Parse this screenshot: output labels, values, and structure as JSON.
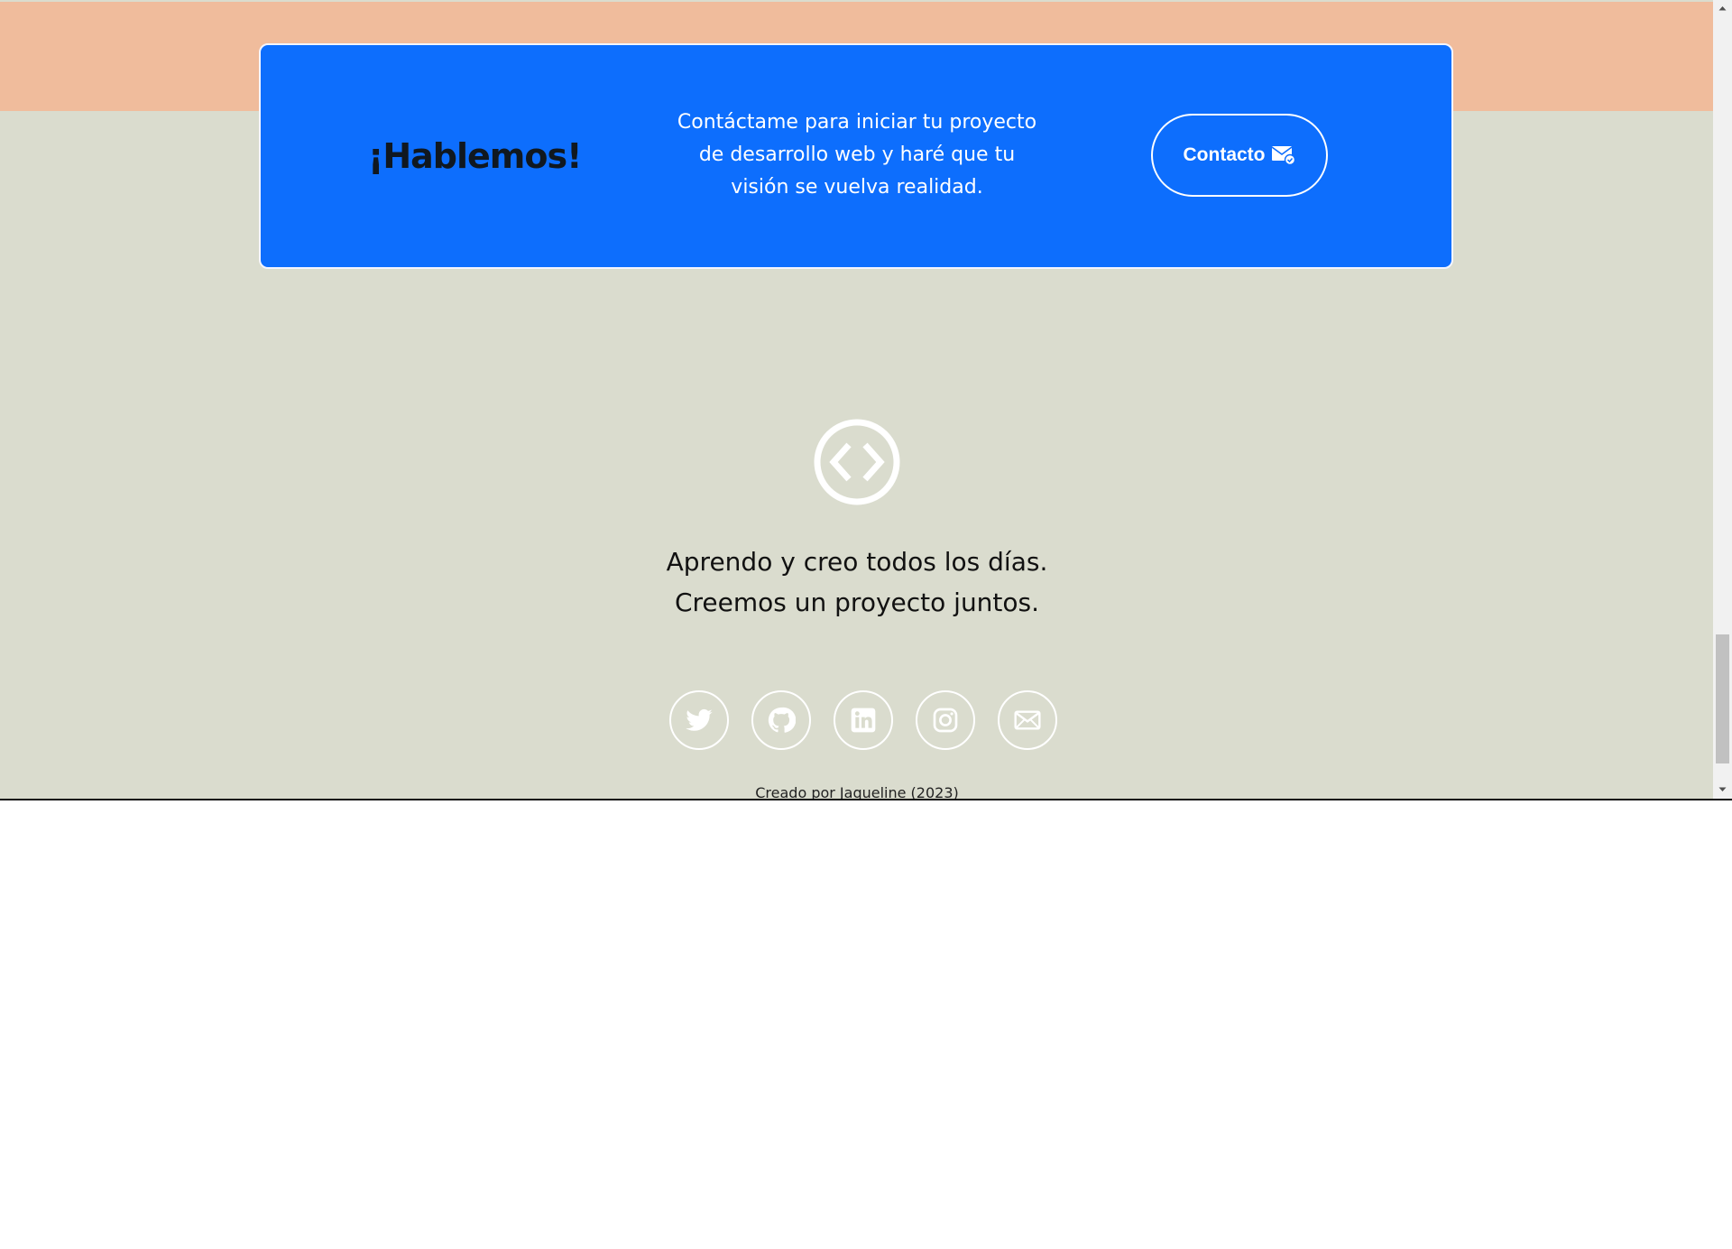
{
  "cta": {
    "title": "¡Hablemos!",
    "text": "Contáctame para iniciar tu proyecto de desarrollo web y haré que tu visión se vuelva realidad.",
    "button_label": "Contacto",
    "button_icon": "mail-check-icon"
  },
  "footer": {
    "logo_icon": "code-brackets-logo",
    "tagline_line1": "Aprendo y creo todos los días.",
    "tagline_line2": "Creemos un proyecto juntos.",
    "credit": "Creado por Jaqueline (2023)",
    "socials": [
      {
        "name": "twitter",
        "icon": "twitter-icon"
      },
      {
        "name": "github",
        "icon": "github-icon"
      },
      {
        "name": "linkedin",
        "icon": "linkedin-icon"
      },
      {
        "name": "instagram",
        "icon": "instagram-icon"
      },
      {
        "name": "email",
        "icon": "mail-icon"
      }
    ]
  },
  "colors": {
    "card_blue": "#0d6efd",
    "top_band": "#f0bc9c",
    "page_bg": "#dadcce"
  }
}
